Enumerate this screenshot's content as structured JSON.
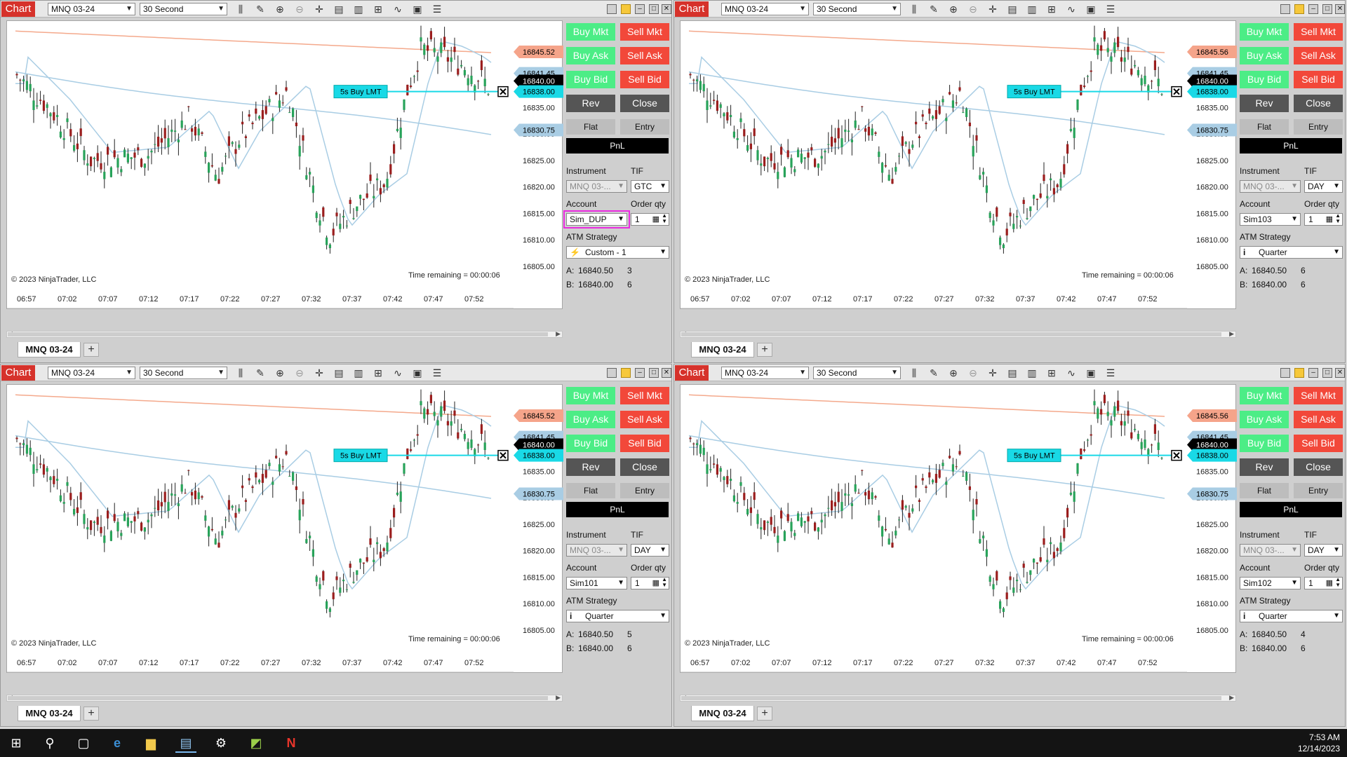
{
  "window_title": "Chart",
  "instrument": "MNQ 03-24",
  "interval": "30 Second",
  "tab_label": "MNQ 03-24",
  "tab_add": "+",
  "copyright": "© 2023 NinjaTrader, LLC",
  "time_remaining": "Time remaining = 00:00:06",
  "order_marker": "5s  Buy LMT",
  "x_ticks": [
    "06:57",
    "07:02",
    "07:07",
    "07:12",
    "07:17",
    "07:22",
    "07:27",
    "07:32",
    "07:37",
    "07:42",
    "07:47",
    "07:52"
  ],
  "y_ticks": [
    "16835.00",
    "16830.00",
    "16825.00",
    "16820.00",
    "16815.00",
    "16810.00",
    "16805.00"
  ],
  "price_tags": {
    "upper_band": "16845.52",
    "last_high": "16841.45",
    "last": "16840.00",
    "order": "16838.00",
    "lower_band": "16830.75"
  },
  "buttons": {
    "buy_mkt": "Buy Mkt",
    "sell_mkt": "Sell Mkt",
    "buy_ask": "Buy Ask",
    "sell_ask": "Sell Ask",
    "buy_bid": "Buy Bid",
    "sell_bid": "Sell Bid",
    "rev": "Rev",
    "close": "Close"
  },
  "status": {
    "flat": "Flat",
    "entry": "Entry",
    "pnl": "PnL"
  },
  "labels": {
    "instrument": "Instrument",
    "tif": "TIF",
    "account": "Account",
    "order_qty": "Order qty",
    "atm_strategy": "ATM Strategy"
  },
  "instrument_field": "MNQ 03-...",
  "qty_value": "1",
  "ask_label": "A:",
  "bid_label": "B:",
  "ask_price": "16840.50",
  "bid_price": "16840.00",
  "panels": [
    {
      "tif": "GTC",
      "account": "Sim_DUP",
      "atm": "Custom - 1",
      "atm_icon": "⚡",
      "ask_size": "3",
      "bid_size": "6",
      "upper_tag": "16845.52"
    },
    {
      "tif": "DAY",
      "account": "Sim103",
      "atm": "Quarter",
      "atm_icon": "i",
      "ask_size": "6",
      "bid_size": "6",
      "upper_tag": "16845.56"
    },
    {
      "tif": "DAY",
      "account": "Sim101",
      "atm": "Quarter",
      "atm_icon": "i",
      "ask_size": "5",
      "bid_size": "6",
      "upper_tag": "16845.52"
    },
    {
      "tif": "DAY",
      "account": "Sim102",
      "atm": "Quarter",
      "atm_icon": "i",
      "ask_size": "4",
      "bid_size": "6",
      "upper_tag": "16845.56"
    }
  ],
  "taskbar": {
    "time": "7:53 AM",
    "date": "12/14/2023"
  },
  "colors": {
    "up_candle": "#28a35a",
    "down_candle": "#9b1e1e",
    "buy": "#4ced86",
    "sell": "#f2483a",
    "order_line": "#19d9e6"
  }
}
